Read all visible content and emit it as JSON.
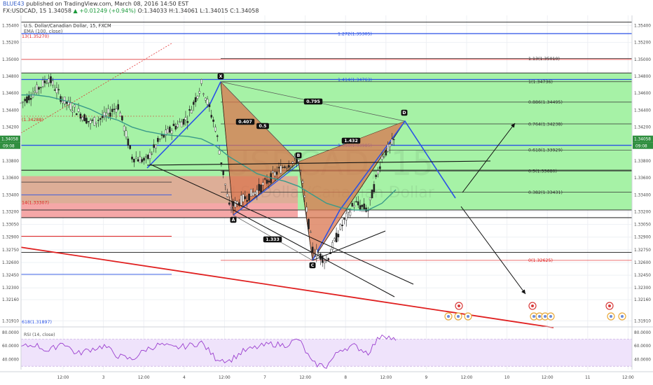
{
  "header": {
    "author": "BLUE43",
    "published": "published on TradingView.com, March 08, 2016 14:50 EST",
    "symbol": "FX:USDCAD, 15",
    "price": "1.34058",
    "change": "▲ +0.01249 (+0.94%)",
    "ohlc": "O:1.34033 H:1.34061 L:1.34015 C:1.34058"
  },
  "legend": {
    "title": "U.S. Dollar/Canadian Dollar, 15, FXCM",
    "ema": "EMA (100, close)",
    "rsi": "RSI (14, close)"
  },
  "watermark": {
    "symbol": "USDCAD, 15",
    "name": "U.S. Dollar/Canadian Dollar"
  },
  "colors": {
    "green_zone": "#a6f2a6",
    "red_zone": "#f5a7a7",
    "pattern_fill": "#d9754f",
    "pattern_blue": "#2a52e6",
    "ema": "#3a9a8a",
    "rsi_line": "#9b3fcf",
    "trendline": "#e02020"
  },
  "price_axis": {
    "ticks": [
      "1.35400",
      "1.35200",
      "1.35000",
      "1.34800",
      "1.34600",
      "1.34400",
      "1.34200",
      "1.34000",
      "1.33800",
      "1.33600",
      "1.33400",
      "1.33200",
      "1.33050",
      "1.32900",
      "1.32750",
      "1.32600",
      "1.32450",
      "1.32300",
      "1.32160",
      "1.31910"
    ],
    "current_label": "1.34058",
    "current_time": "09:08"
  },
  "rsi_axis": {
    "ticks": [
      "80.0000",
      "60.0000",
      "40.0000"
    ]
  },
  "time_axis": [
    "12:00",
    "3",
    "12:00",
    "4",
    "12:00",
    "7",
    "12:00",
    "8",
    "12:00",
    "9",
    "12:00",
    "10",
    "12:00",
    "11",
    "12:00"
  ],
  "fib_levels": [
    {
      "label": "1.272(1.35305)",
      "price": 1.35305,
      "color": "#2a52e6"
    },
    {
      "label": "1.13(1.35010)",
      "price": 1.3501,
      "color": "#333333"
    },
    {
      "label": "1.414(1.34763)",
      "price": 1.34763,
      "color": "#2a52e6"
    },
    {
      "label": "1(1.34736)",
      "price": 1.34736,
      "color": "#333333"
    },
    {
      "label": "0.886(1.34495)",
      "price": 1.34495,
      "color": "#333333"
    },
    {
      "label": "0.764(1.34238)",
      "price": 1.34238,
      "color": "#333333"
    },
    {
      "label": "1.618(1.33985)",
      "price": 1.33985,
      "color": "#2a52e6"
    },
    {
      "label": "0.618(1.33929)",
      "price": 1.33929,
      "color": "#333333"
    },
    {
      "label": "0.5(1.33680)",
      "price": 1.3368,
      "color": "#333333"
    },
    {
      "label": "0.382(1.33431)",
      "price": 1.33431,
      "color": "#333333"
    },
    {
      "label": "0(1.32625)",
      "price": 1.32625,
      "color": "#e02020"
    }
  ],
  "left_labels": [
    {
      "label": "13(1.35270)",
      "price": 1.3527,
      "color": "#e02020"
    },
    {
      "label": "(1.34288)",
      "price": 1.34288,
      "color": "#e02020"
    },
    {
      "label": "14(1.33307)",
      "price": 1.33307,
      "color": "#e02020"
    },
    {
      "label": "618(1.31897)",
      "price": 1.31897,
      "color": "#2a52e6"
    }
  ],
  "ratios": [
    {
      "label": "0.795"
    },
    {
      "label": "0.407"
    },
    {
      "label": "0.5"
    },
    {
      "label": "1.432"
    },
    {
      "label": "1.333"
    }
  ],
  "points": [
    "X",
    "A",
    "B",
    "C",
    "D"
  ],
  "chart_data": {
    "type": "line",
    "title": "U.S. Dollar/Canadian Dollar, 15, FXCM",
    "xlabel": "",
    "ylabel": "",
    "ylim": [
      1.3188,
      1.3552
    ],
    "x": [
      0,
      1,
      2,
      3,
      4,
      5,
      6,
      7,
      8,
      9,
      10,
      11,
      12,
      13,
      14,
      15,
      16,
      17,
      18,
      19,
      20,
      21,
      22,
      23,
      24,
      25,
      26,
      27
    ],
    "series": [
      {
        "values": [
          1.3448,
          1.3462,
          1.3478,
          1.3452,
          1.344,
          1.3425,
          1.3432,
          1.3445,
          1.3385,
          1.338,
          1.3405,
          1.342,
          1.3431,
          1.3471,
          1.342,
          1.3325,
          1.3335,
          1.3345,
          1.336,
          1.3375,
          1.3382,
          1.3275,
          1.3262,
          1.33,
          1.333,
          1.3322,
          1.3385,
          1.3406
        ]
      },
      {
        "name": "EMA (100, close)",
        "values": [
          1.3458,
          1.3458,
          1.3456,
          1.3452,
          1.3447,
          1.3441,
          1.3433,
          1.3428,
          1.342,
          1.3415,
          1.3412,
          1.341,
          1.3409,
          1.3406,
          1.3398,
          1.3385,
          1.3375,
          1.3365,
          1.336,
          1.3356,
          1.335,
          1.334,
          1.333,
          1.3325,
          1.3322,
          1.3322,
          1.333,
          1.3346
        ]
      }
    ],
    "pattern": {
      "X": 1.34736,
      "A": 1.3316,
      "B": 1.3379,
      "C": 1.32625,
      "D": 1.3427
    },
    "rsi": {
      "name": "RSI (14, close)",
      "ylim": [
        25,
        85
      ],
      "values": [
        58,
        62,
        52,
        66,
        48,
        55,
        60,
        45,
        40,
        55,
        62,
        57,
        60,
        65,
        42,
        38,
        52,
        58,
        63,
        61,
        70,
        34,
        30,
        55,
        60,
        50,
        78,
        68
      ]
    }
  }
}
